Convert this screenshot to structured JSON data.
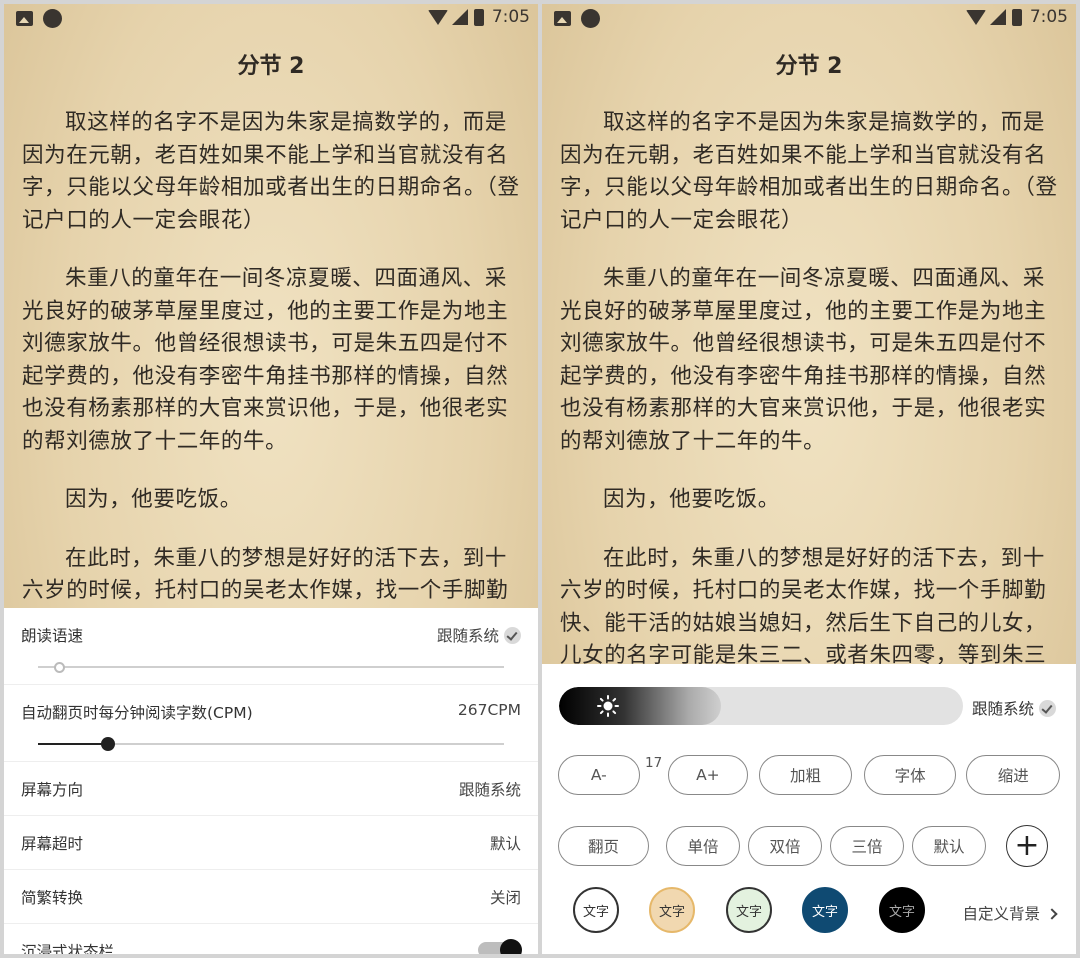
{
  "status_bar": {
    "time": "7:05"
  },
  "reader": {
    "chapter_title": "分节 2",
    "left_paragraphs": [
      "取这样的名字不是因为朱家是搞数学的，而是因为在元朝，老百姓如果不能上学和当官就没有名字，只能以父母年龄相加或者出生的日期命名。（登记户口的人一定会眼花）",
      "朱重八的童年在一间冬凉夏暖、四面通风、采光良好的破茅草屋里度过，他的主要工作是为地主刘德家放牛。他曾经很想读书，可是朱五四是付不起学费的，他没有李密牛角挂书那样的情操，自然也没有杨素那样的大官来赏识他，于是，他很老实的帮刘德放了十二年的牛。",
      "因为，他要吃饭。",
      "在此时，朱重八的梦想是好好的活下去，到十六岁的时候，托村口的吴老太作媒，找一个手脚勤"
    ],
    "right_paragraphs": [
      "取这样的名字不是因为朱家是搞数学的，而是因为在元朝，老百姓如果不能上学和当官就没有名字，只能以父母年龄相加或者出生的日期命名。（登记户口的人一定会眼花）",
      "朱重八的童年在一间冬凉夏暖、四面通风、采光良好的破茅草屋里度过，他的主要工作是为地主刘德家放牛。他曾经很想读书，可是朱五四是付不起学费的，他没有李密牛角挂书那样的情操，自然也没有杨素那样的大官来赏识他，于是，他很老实的帮刘德放了十二年的牛。",
      "因为，他要吃饭。",
      "在此时，朱重八的梦想是好好的活下去，到十六岁的时候，托村口的吴老太作媒，找一个手脚勤快、能干活的姑娘当媳妇，然后生下自己的儿女，儿女的名字可能是朱三二、或者朱四零，等到朱三"
    ]
  },
  "settings": {
    "read_speed": {
      "label": "朗读语速",
      "value": "跟随系统",
      "level": 0.05
    },
    "cpm": {
      "label": "自动翻页时每分钟阅读字数(CPM)",
      "value": "267CPM",
      "level": 0.15
    },
    "orientation": {
      "label": "屏幕方向",
      "value": "跟随系统"
    },
    "timeout": {
      "label": "屏幕超时",
      "value": "默认"
    },
    "conversion": {
      "label": "简繁转换",
      "value": "关闭"
    },
    "immersive": {
      "label": "沉浸式状态栏",
      "enabled": true
    }
  },
  "style_panel": {
    "brightness_level": 0.4,
    "follow_system": "跟随系统",
    "font_row": {
      "decrease": "A-",
      "size": "17",
      "increase": "A+",
      "bold": "加粗",
      "font": "字体",
      "indent": "缩进"
    },
    "spacing_row": {
      "page_turn": "翻页",
      "single": "单倍",
      "double": "双倍",
      "triple": "三倍",
      "default": "默认",
      "add": "+"
    },
    "themes": [
      {
        "label": "文字",
        "bg": "#ffffff",
        "fg": "#333333",
        "border": "#333333"
      },
      {
        "label": "文字",
        "bg": "#f1d8b0",
        "fg": "#333333",
        "border": "#e6b86a"
      },
      {
        "label": "文字",
        "bg": "#e3f2df",
        "fg": "#333333",
        "border": "#333333"
      },
      {
        "label": "文字",
        "bg": "#0f4a72",
        "fg": "#ffffff",
        "border": "#0f4a72"
      },
      {
        "label": "文字",
        "bg": "#000000",
        "fg": "#aaaaaa",
        "border": "#000000"
      }
    ],
    "custom_bg": "自定义背景"
  }
}
